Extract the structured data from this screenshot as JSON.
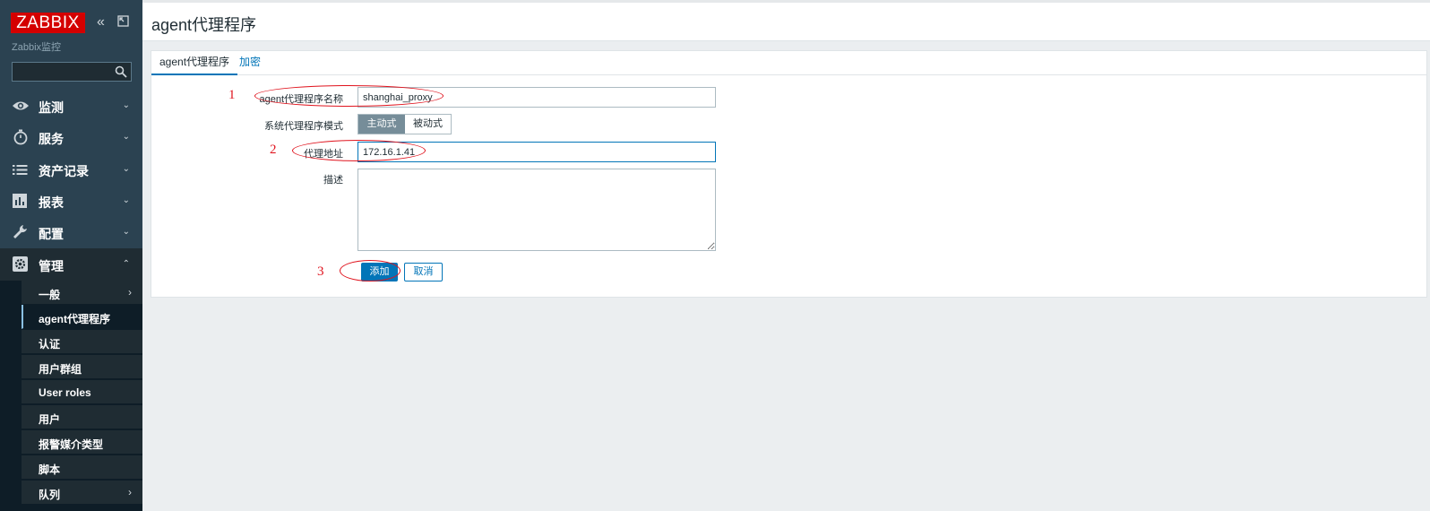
{
  "sidebar": {
    "logo": "ZABBIX",
    "subtitle": "Zabbix监控",
    "search": {
      "value": "",
      "placeholder": ""
    },
    "collapse_icon": "double-chevron-left-icon",
    "kiosk_icon": "expand-icon",
    "menu": [
      {
        "label": "监测",
        "icon": "eye-icon",
        "chevron": "⌄"
      },
      {
        "label": "服务",
        "icon": "stopwatch-icon",
        "chevron": "⌄"
      },
      {
        "label": "资产记录",
        "icon": "list-icon",
        "chevron": "⌄"
      },
      {
        "label": "报表",
        "icon": "bar-chart-icon",
        "chevron": "⌄"
      },
      {
        "label": "配置",
        "icon": "wrench-icon",
        "chevron": "⌄"
      },
      {
        "label": "管理",
        "icon": "gear-icon",
        "chevron": "⌃"
      }
    ],
    "submenu": [
      {
        "label": "一般",
        "chevron": "›"
      },
      {
        "label": "agent代理程序",
        "chevron": ""
      },
      {
        "label": "认证",
        "chevron": ""
      },
      {
        "label": "用户群组",
        "chevron": ""
      },
      {
        "label": "User roles",
        "chevron": ""
      },
      {
        "label": "用户",
        "chevron": ""
      },
      {
        "label": "报警媒介类型",
        "chevron": ""
      },
      {
        "label": "脚本",
        "chevron": ""
      },
      {
        "label": "队列",
        "chevron": "›"
      }
    ]
  },
  "header": {
    "title": "agent代理程序"
  },
  "tabs": [
    {
      "label": "agent代理程序"
    },
    {
      "label": "加密"
    }
  ],
  "form": {
    "name_label": "agent代理程序名称",
    "name_value": "shanghai_proxy",
    "mode_label": "系统代理程序模式",
    "mode_options": [
      "主动式",
      "被动式"
    ],
    "mode_selected": "主动式",
    "address_label": "代理地址",
    "address_value": "172.16.1.41",
    "description_label": "描述",
    "description_value": "",
    "add_button": "添加",
    "cancel_button": "取消"
  },
  "annotations": {
    "n1": "1",
    "n2": "2",
    "n3": "3",
    "color": "#e0141e"
  },
  "colors": {
    "sidebar": "#2b4251",
    "sidebar_dark": "#1f2c33",
    "logo": "#d40000",
    "accent": "#0275b8"
  }
}
